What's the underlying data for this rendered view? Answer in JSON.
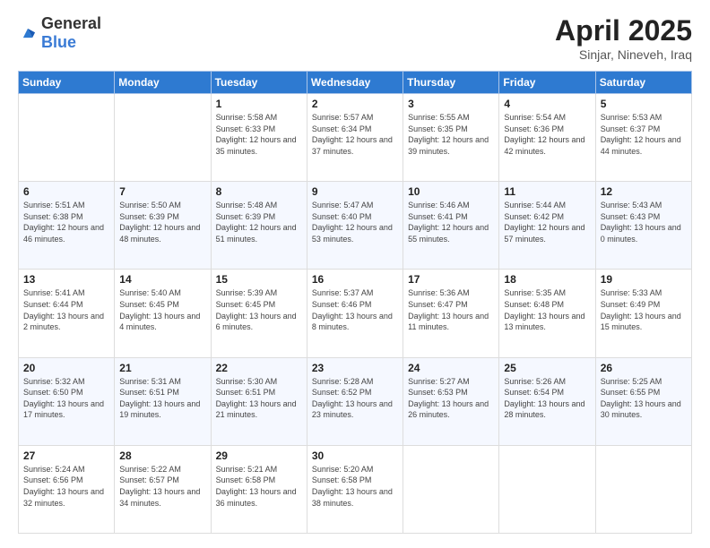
{
  "logo": {
    "general": "General",
    "blue": "Blue"
  },
  "title": {
    "month": "April 2025",
    "location": "Sinjar, Nineveh, Iraq"
  },
  "days": [
    "Sunday",
    "Monday",
    "Tuesday",
    "Wednesday",
    "Thursday",
    "Friday",
    "Saturday"
  ],
  "weeks": [
    [
      {
        "day": "",
        "sunrise": "",
        "sunset": "",
        "daylight": ""
      },
      {
        "day": "",
        "sunrise": "",
        "sunset": "",
        "daylight": ""
      },
      {
        "day": "1",
        "sunrise": "Sunrise: 5:58 AM",
        "sunset": "Sunset: 6:33 PM",
        "daylight": "Daylight: 12 hours and 35 minutes."
      },
      {
        "day": "2",
        "sunrise": "Sunrise: 5:57 AM",
        "sunset": "Sunset: 6:34 PM",
        "daylight": "Daylight: 12 hours and 37 minutes."
      },
      {
        "day": "3",
        "sunrise": "Sunrise: 5:55 AM",
        "sunset": "Sunset: 6:35 PM",
        "daylight": "Daylight: 12 hours and 39 minutes."
      },
      {
        "day": "4",
        "sunrise": "Sunrise: 5:54 AM",
        "sunset": "Sunset: 6:36 PM",
        "daylight": "Daylight: 12 hours and 42 minutes."
      },
      {
        "day": "5",
        "sunrise": "Sunrise: 5:53 AM",
        "sunset": "Sunset: 6:37 PM",
        "daylight": "Daylight: 12 hours and 44 minutes."
      }
    ],
    [
      {
        "day": "6",
        "sunrise": "Sunrise: 5:51 AM",
        "sunset": "Sunset: 6:38 PM",
        "daylight": "Daylight: 12 hours and 46 minutes."
      },
      {
        "day": "7",
        "sunrise": "Sunrise: 5:50 AM",
        "sunset": "Sunset: 6:39 PM",
        "daylight": "Daylight: 12 hours and 48 minutes."
      },
      {
        "day": "8",
        "sunrise": "Sunrise: 5:48 AM",
        "sunset": "Sunset: 6:39 PM",
        "daylight": "Daylight: 12 hours and 51 minutes."
      },
      {
        "day": "9",
        "sunrise": "Sunrise: 5:47 AM",
        "sunset": "Sunset: 6:40 PM",
        "daylight": "Daylight: 12 hours and 53 minutes."
      },
      {
        "day": "10",
        "sunrise": "Sunrise: 5:46 AM",
        "sunset": "Sunset: 6:41 PM",
        "daylight": "Daylight: 12 hours and 55 minutes."
      },
      {
        "day": "11",
        "sunrise": "Sunrise: 5:44 AM",
        "sunset": "Sunset: 6:42 PM",
        "daylight": "Daylight: 12 hours and 57 minutes."
      },
      {
        "day": "12",
        "sunrise": "Sunrise: 5:43 AM",
        "sunset": "Sunset: 6:43 PM",
        "daylight": "Daylight: 13 hours and 0 minutes."
      }
    ],
    [
      {
        "day": "13",
        "sunrise": "Sunrise: 5:41 AM",
        "sunset": "Sunset: 6:44 PM",
        "daylight": "Daylight: 13 hours and 2 minutes."
      },
      {
        "day": "14",
        "sunrise": "Sunrise: 5:40 AM",
        "sunset": "Sunset: 6:45 PM",
        "daylight": "Daylight: 13 hours and 4 minutes."
      },
      {
        "day": "15",
        "sunrise": "Sunrise: 5:39 AM",
        "sunset": "Sunset: 6:45 PM",
        "daylight": "Daylight: 13 hours and 6 minutes."
      },
      {
        "day": "16",
        "sunrise": "Sunrise: 5:37 AM",
        "sunset": "Sunset: 6:46 PM",
        "daylight": "Daylight: 13 hours and 8 minutes."
      },
      {
        "day": "17",
        "sunrise": "Sunrise: 5:36 AM",
        "sunset": "Sunset: 6:47 PM",
        "daylight": "Daylight: 13 hours and 11 minutes."
      },
      {
        "day": "18",
        "sunrise": "Sunrise: 5:35 AM",
        "sunset": "Sunset: 6:48 PM",
        "daylight": "Daylight: 13 hours and 13 minutes."
      },
      {
        "day": "19",
        "sunrise": "Sunrise: 5:33 AM",
        "sunset": "Sunset: 6:49 PM",
        "daylight": "Daylight: 13 hours and 15 minutes."
      }
    ],
    [
      {
        "day": "20",
        "sunrise": "Sunrise: 5:32 AM",
        "sunset": "Sunset: 6:50 PM",
        "daylight": "Daylight: 13 hours and 17 minutes."
      },
      {
        "day": "21",
        "sunrise": "Sunrise: 5:31 AM",
        "sunset": "Sunset: 6:51 PM",
        "daylight": "Daylight: 13 hours and 19 minutes."
      },
      {
        "day": "22",
        "sunrise": "Sunrise: 5:30 AM",
        "sunset": "Sunset: 6:51 PM",
        "daylight": "Daylight: 13 hours and 21 minutes."
      },
      {
        "day": "23",
        "sunrise": "Sunrise: 5:28 AM",
        "sunset": "Sunset: 6:52 PM",
        "daylight": "Daylight: 13 hours and 23 minutes."
      },
      {
        "day": "24",
        "sunrise": "Sunrise: 5:27 AM",
        "sunset": "Sunset: 6:53 PM",
        "daylight": "Daylight: 13 hours and 26 minutes."
      },
      {
        "day": "25",
        "sunrise": "Sunrise: 5:26 AM",
        "sunset": "Sunset: 6:54 PM",
        "daylight": "Daylight: 13 hours and 28 minutes."
      },
      {
        "day": "26",
        "sunrise": "Sunrise: 5:25 AM",
        "sunset": "Sunset: 6:55 PM",
        "daylight": "Daylight: 13 hours and 30 minutes."
      }
    ],
    [
      {
        "day": "27",
        "sunrise": "Sunrise: 5:24 AM",
        "sunset": "Sunset: 6:56 PM",
        "daylight": "Daylight: 13 hours and 32 minutes."
      },
      {
        "day": "28",
        "sunrise": "Sunrise: 5:22 AM",
        "sunset": "Sunset: 6:57 PM",
        "daylight": "Daylight: 13 hours and 34 minutes."
      },
      {
        "day": "29",
        "sunrise": "Sunrise: 5:21 AM",
        "sunset": "Sunset: 6:58 PM",
        "daylight": "Daylight: 13 hours and 36 minutes."
      },
      {
        "day": "30",
        "sunrise": "Sunrise: 5:20 AM",
        "sunset": "Sunset: 6:58 PM",
        "daylight": "Daylight: 13 hours and 38 minutes."
      },
      {
        "day": "",
        "sunrise": "",
        "sunset": "",
        "daylight": ""
      },
      {
        "day": "",
        "sunrise": "",
        "sunset": "",
        "daylight": ""
      },
      {
        "day": "",
        "sunrise": "",
        "sunset": "",
        "daylight": ""
      }
    ]
  ]
}
